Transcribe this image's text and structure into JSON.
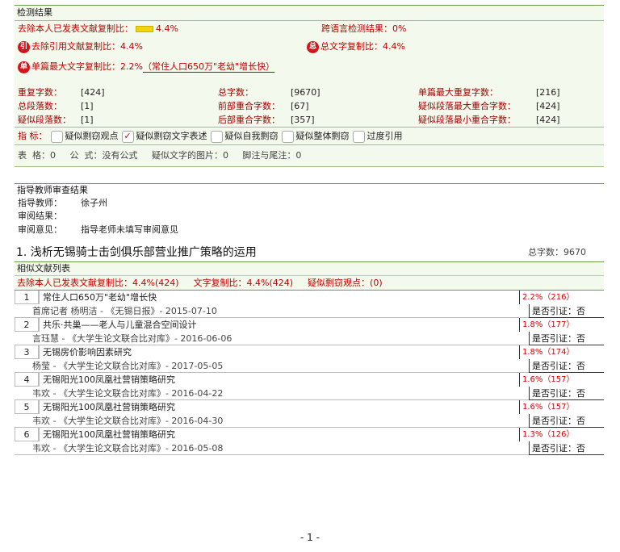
{
  "detect": {
    "header": "检测结果",
    "exclude_self_label": "去除本人已发表文献复制比：",
    "exclude_self_value": "4.4%",
    "cross_lang_label": "跨语言检测结果：",
    "cross_lang_value": "0%",
    "badge_yin": "引",
    "exclude_quote_label": "去除引用文献复制比：",
    "exclude_quote_value": "4.4%",
    "badge_zong": "总",
    "total_copy_label": "总文字复制比：",
    "total_copy_value": "4.4%",
    "badge_dan": "单",
    "single_max_label": "单篇最大文字复制比：",
    "single_max_value": "2.2%",
    "single_max_source": "（常住人口650万\"老幼\"增长快）",
    "stats": [
      {
        "key": "重复字数：",
        "val": "[424]"
      },
      {
        "key": "总字数：",
        "val": "[9670]"
      },
      {
        "key": "单篇最大重复字数：",
        "val": "[216]"
      },
      {
        "key": "总段落数：",
        "val": "[1]"
      },
      {
        "key": "前部重合字数：",
        "val": "[67]"
      },
      {
        "key": "疑似段落最大重合字数：",
        "val": "[424]"
      },
      {
        "key": "疑似段落数：",
        "val": "[1]"
      },
      {
        "key": "后部重合字数：",
        "val": "[357]"
      },
      {
        "key": "疑似段落最小重合字数：",
        "val": "[424]"
      }
    ],
    "indicator_label": "指  标：",
    "indicators": [
      {
        "label": "疑似剽窃观点",
        "checked": false
      },
      {
        "label": "疑似剽窃文字表述",
        "checked": true
      },
      {
        "label": "疑似自我剽窃",
        "checked": false
      },
      {
        "label": "疑似整体剽窃",
        "checked": false
      },
      {
        "label": "过度引用",
        "checked": false
      }
    ],
    "check_mark": "✓",
    "misc": "表  格：0     公  式：没有公式     疑似文字的图片：0     脚注与尾注：0"
  },
  "review": {
    "header": "指导教师审查结果",
    "teacher_label": "指导教师：",
    "teacher_value": "徐子州",
    "result_label": "审阅结果：",
    "opinion_label": "审阅意见：",
    "opinion_value": "指导老师未填写审阅意见"
  },
  "paper": {
    "title": "1. 浅析无锡骑士击剑俱乐部营业推广策略的运用",
    "count": "总字数：9670",
    "list_header": "相似文献列表",
    "sum_exclude": "去除本人已发表文献复制比：4.4%(424)",
    "sum_copy": "文字复制比：4.4%(424)",
    "sum_plag": "疑似剽窃观点：(0)",
    "items": [
      {
        "num": "1",
        "title": "常住人口650万\"老幼\"增长快",
        "pct": "2.2%（216）",
        "source": "首席记者  杨明洁 - 《无锡日报》- 2015-07-10",
        "cite": "是否引证：否"
      },
      {
        "num": "2",
        "title": "共乐·共巢——老人与儿童混合空间设计",
        "pct": "1.8%（177）",
        "source": "言珏慧 - 《大学生论文联合比对库》- 2016-06-06",
        "cite": "是否引证：否"
      },
      {
        "num": "3",
        "title": "无锡房价影响因素研究",
        "pct": "1.8%（174）",
        "source": "杨莹 - 《大学生论文联合比对库》- 2017-05-05",
        "cite": "是否引证：否"
      },
      {
        "num": "4",
        "title": "无锡阳光100凤凰社营销策略研究",
        "pct": "1.6%（157）",
        "source": "韦欢 - 《大学生论文联合比对库》- 2016-04-22",
        "cite": "是否引证：否"
      },
      {
        "num": "5",
        "title": "无锡阳光100凤凰社营销策略研究",
        "pct": "1.6%（157）",
        "source": "韦欢 - 《大学生论文联合比对库》- 2016-04-30",
        "cite": "是否引证：否"
      },
      {
        "num": "6",
        "title": "无锡阳光100凤凰社营销策略研究",
        "pct": "1.3%（126）",
        "source": "韦欢 - 《大学生论文联合比对库》- 2016-05-08",
        "cite": "是否引证：否"
      }
    ]
  },
  "footer": {
    "page": "- 1 -"
  },
  "colors": {
    "accent_red": "#c00000",
    "panel_bg": "#f3f9ec",
    "border_green": "#6a9a4a",
    "bar_yellow": "#f2d40a"
  }
}
